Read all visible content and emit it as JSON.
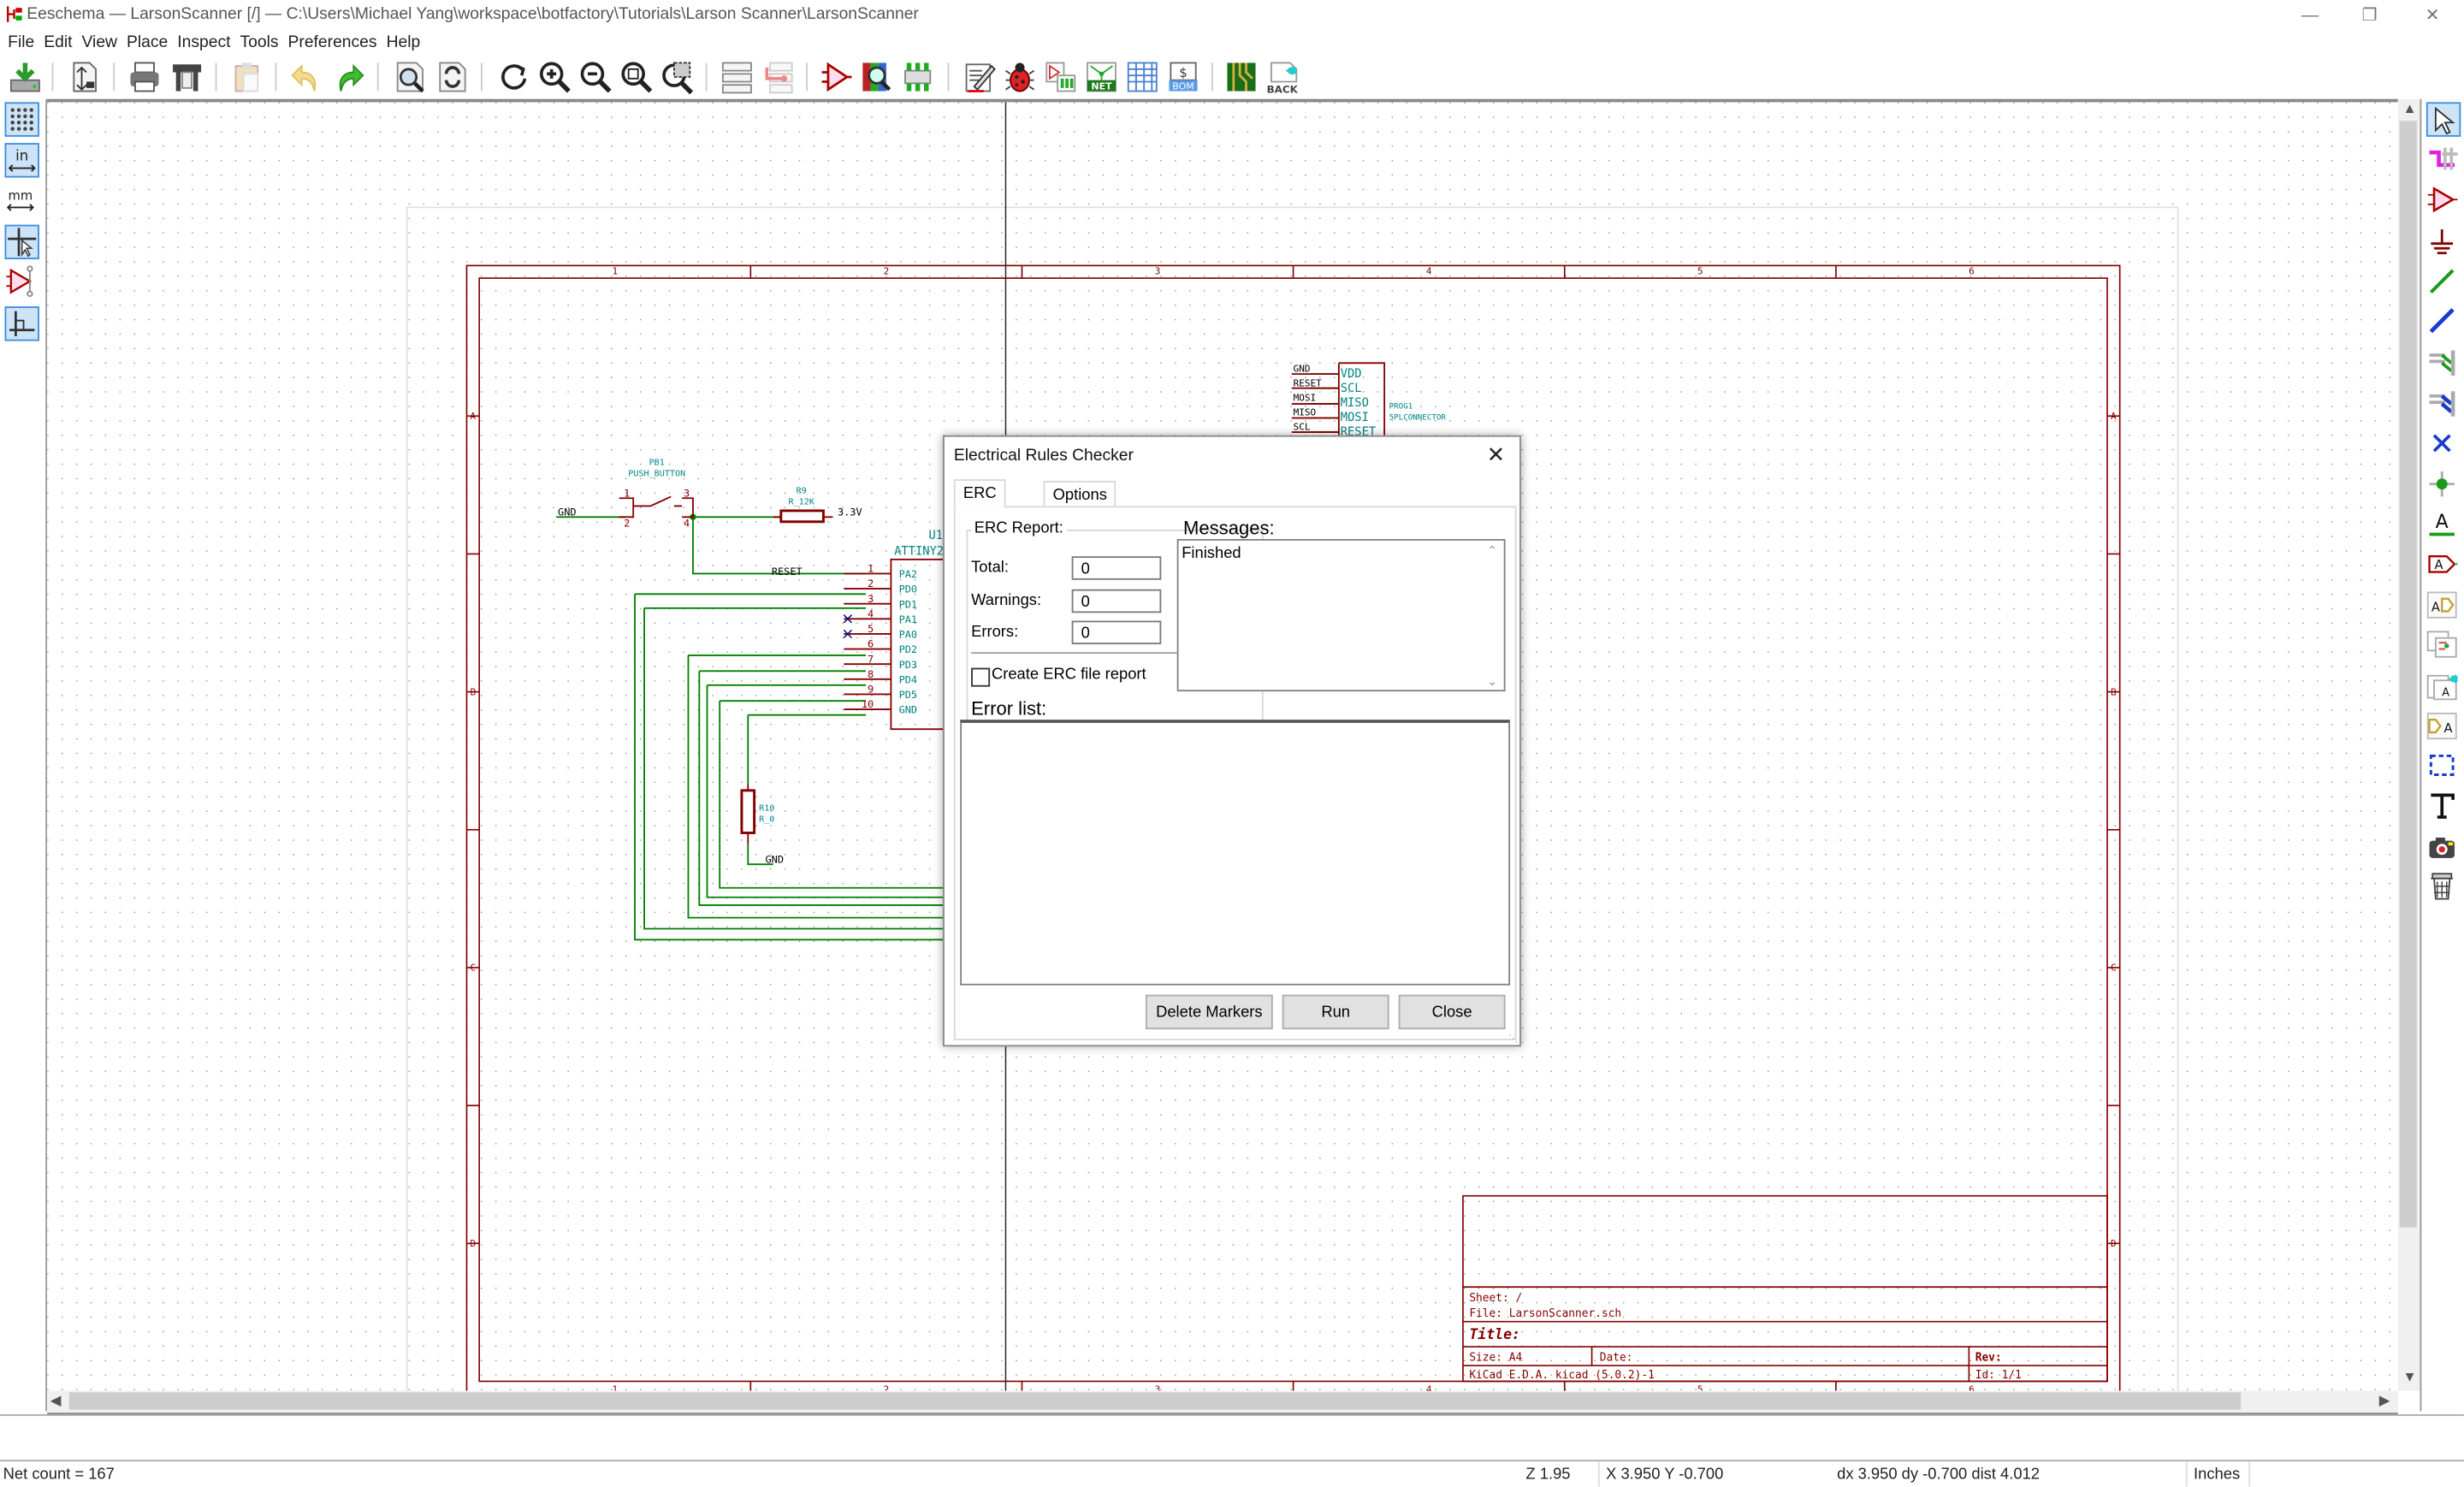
{
  "window": {
    "title": "Eeschema — LarsonScanner [/] — C:\\Users\\Michael Yang\\workspace\\botfactory\\Tutorials\\Larson Scanner\\LarsonScanner",
    "controls": [
      "minimize",
      "restore",
      "close"
    ]
  },
  "menu": [
    "File",
    "Edit",
    "View",
    "Place",
    "Inspect",
    "Tools",
    "Preferences",
    "Help"
  ],
  "toolbar": {
    "buttons": [
      "save-icon",
      "page-settings-icon",
      "print-icon",
      "plot-icon",
      "paste-icon",
      "undo-icon",
      "redo-icon",
      "find-icon",
      "find-replace-icon",
      "redraw-icon",
      "zoom-in-icon",
      "zoom-out-icon",
      "zoom-fit-icon",
      "zoom-selection-icon",
      "hierarchy-navigator-icon",
      "leave-sheet-icon",
      "symbol-editor-icon",
      "symbol-browser-icon",
      "footprint-assignment-icon",
      "annotate-icon",
      "erc-icon",
      "assign-footprints-icon",
      "netlist-icon",
      "bom-table-icon",
      "bom-icon",
      "pcbnew-icon",
      "back-annotate-icon"
    ],
    "back_label": "BACK",
    "net_label": "NET",
    "bom_label": "BOM"
  },
  "left_toolbar": {
    "buttons": [
      {
        "name": "grid-toggle-icon",
        "active": true
      },
      {
        "name": "units-inches-icon",
        "label": "in",
        "active": true
      },
      {
        "name": "units-mm-icon",
        "label": "mm",
        "active": false
      },
      {
        "name": "cursor-shape-icon",
        "active": true
      },
      {
        "name": "hidden-pins-icon",
        "active": false
      },
      {
        "name": "wire-angle-icon",
        "active": true
      }
    ]
  },
  "right_toolbar": {
    "buttons": [
      {
        "name": "select-arrow-icon",
        "active": true
      },
      {
        "name": "highlight-net-icon"
      },
      {
        "name": "add-symbol-icon"
      },
      {
        "name": "add-power-icon"
      },
      {
        "name": "add-wire-icon"
      },
      {
        "name": "add-bus-icon"
      },
      {
        "name": "wire-bus-entry-icon"
      },
      {
        "name": "bus-bus-entry-icon"
      },
      {
        "name": "no-connect-flag-icon"
      },
      {
        "name": "add-junction-icon"
      },
      {
        "name": "add-net-label-icon"
      },
      {
        "name": "add-global-label-icon"
      },
      {
        "name": "add-hier-label-icon"
      },
      {
        "name": "add-hier-sheet-icon"
      },
      {
        "name": "import-sheet-pin-icon"
      },
      {
        "name": "add-sheet-pin-icon"
      },
      {
        "name": "add-graphic-lines-icon"
      },
      {
        "name": "add-text-icon"
      },
      {
        "name": "add-image-icon"
      },
      {
        "name": "delete-item-icon"
      }
    ]
  },
  "schematic": {
    "colors": {
      "wire": "#008000",
      "body": "#840000",
      "ref": "#008484",
      "pin_num": "#840000",
      "no_connect": "#000084",
      "text": "#000000"
    },
    "frame": {
      "columns": [
        "1",
        "2",
        "3",
        "4",
        "5",
        "6"
      ],
      "rows": [
        "A",
        "B",
        "C",
        "D"
      ]
    },
    "pb1": {
      "ref": "PB1",
      "value": "PUSH_BUTTON",
      "pins": [
        "1",
        "2",
        "3",
        "4"
      ]
    },
    "r9": {
      "ref": "R9",
      "value": "R_12K"
    },
    "r10": {
      "ref": "R10",
      "value": "R_0"
    },
    "power": {
      "vcc": "3.3V",
      "gnd": "GND"
    },
    "u1": {
      "ref": "U1",
      "value": "ATTINY2",
      "pins": [
        {
          "num": "1",
          "name": "PA2"
        },
        {
          "num": "2",
          "name": "PD0"
        },
        {
          "num": "3",
          "name": "PD1"
        },
        {
          "num": "4",
          "name": "PA1"
        },
        {
          "num": "5",
          "name": "PA0"
        },
        {
          "num": "6",
          "name": "PD2"
        },
        {
          "num": "7",
          "name": "PD3"
        },
        {
          "num": "8",
          "name": "PD4"
        },
        {
          "num": "9",
          "name": "PD5"
        },
        {
          "num": "10",
          "name": "GND"
        }
      ]
    },
    "reset_label": "RESET",
    "prog1": {
      "ref": "PROG1",
      "value": "5PLCONNECTOR",
      "nets": [
        "GND",
        "RESET",
        "MOSI",
        "MISO",
        "SCL"
      ],
      "pins": [
        "VDD",
        "SCL",
        "MISO",
        "MOSI",
        "RESET"
      ]
    },
    "title_block": {
      "sheet": "Sheet: /",
      "file": "File: LarsonScanner.sch",
      "title": "Title:",
      "size": "Size: A4",
      "date": "Date:",
      "rev": "Rev:",
      "tool": "KiCad E.D.A.  kicad (5.0.2)-1",
      "id": "Id: 1/1"
    }
  },
  "dialog": {
    "title": "Electrical Rules Checker",
    "tabs": [
      {
        "label": "ERC",
        "active": true
      },
      {
        "label": "Options",
        "active": false
      }
    ],
    "report_group": "ERC Report:",
    "total_label": "Total:",
    "total_value": "0",
    "warnings_label": "Warnings:",
    "warnings_value": "0",
    "errors_label": "Errors:",
    "errors_value": "0",
    "create_report_label": "Create ERC file report",
    "create_report_checked": false,
    "messages_label": "Messages:",
    "messages_text": "Finished",
    "error_list_label": "Error list:",
    "buttons": {
      "delete_markers": "Delete Markers",
      "run": "Run",
      "close": "Close"
    }
  },
  "status": {
    "net_count": "Net count = 167",
    "zoom": "Z 1.95",
    "xy": "X 3.950  Y -0.700",
    "delta": "dx 3.950  dy -0.700  dist 4.012",
    "units": "Inches"
  }
}
